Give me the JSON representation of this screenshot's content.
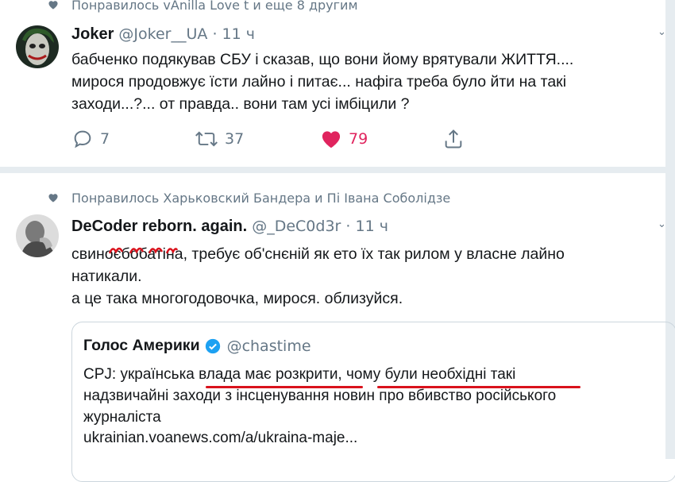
{
  "tweet1": {
    "context": "Понравилось vAnilla Love t и еще 8 другим",
    "author_name": "Joker",
    "author_handle": "@Joker__UA",
    "dot": "·",
    "time": "11 ч",
    "body": [
      "бабченко подякував СБУ і сказав, що вони йому врятували ЖИТТЯ....",
      "мирося продовжує їсти лайно і питає... нафіга треба було йти на такі",
      "заходи...?... от правда.. вони там усі імбіцили ?"
    ],
    "replies": "7",
    "retweets": "37",
    "likes": "79"
  },
  "tweet2": {
    "context": "Понравилось Харьковский Бандера и Пі Івана Соболідзе",
    "author_name": "DeCoder reborn. again.",
    "author_handle": "@_DeC0d3r",
    "dot": "·",
    "time": "11 ч",
    "body": [
      "свиноєбобатіна, требує об'снєній як ето їх так рилом у власне лайно",
      "натикали.",
      "а це така многогодовочка, мирося. облизуйся."
    ],
    "quote": {
      "name": "Голос Америки",
      "handle": "@chastime",
      "body": [
        "CPJ: українська влада має розкрити, чому були необхідні такі",
        "надзвичайні заходи з інсценування новин про вбивство російського",
        "журналіста"
      ],
      "link": "ukrainian.voanews.com/a/ukraina-maje..."
    }
  },
  "colors": {
    "muted": "#657786",
    "like": "#e0245e",
    "verified": "#1da1f2",
    "annotation": "#d9121c",
    "separator": "#e6ecf0"
  }
}
